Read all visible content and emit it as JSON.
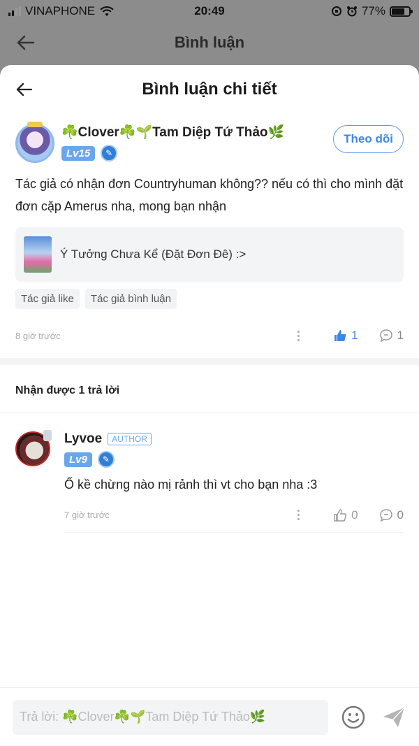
{
  "status": {
    "carrier": "VINAPHONE",
    "time": "20:49",
    "battery_percent": "77%",
    "battery_level": 0.77
  },
  "background_header": {
    "title": "Bình luận"
  },
  "sheet": {
    "title": "Bình luận chi tiết"
  },
  "comment": {
    "username": "☘️Clover☘️🌱Tam Diệp Tứ Thảo🌿",
    "level": "Lv15",
    "follow_label": "Theo dõi",
    "text": "Tác giả có nhận đơn Countryhuman không?? nếu có thì cho mình đặt đơn cặp Amerus nha, mong bạn nhận",
    "story_title": "Ý Tưởng Chưa Kể (Đặt Đơn Đê) :>",
    "tags": [
      "Tác giả like",
      "Tác giả bình luận"
    ],
    "time_ago": "8 giờ trước",
    "likes": "1",
    "replies": "1"
  },
  "replies_section": {
    "title": "Nhận được 1 trả lời"
  },
  "reply": {
    "username": "Lyvoe",
    "author_badge": "AUTHOR",
    "level": "Lv9",
    "text": "Ố kề chừng nào mị rảnh thì vt cho bạn nha :3",
    "time_ago": "7 giờ trước",
    "likes": "0",
    "replies": "0"
  },
  "input": {
    "placeholder": "Trả lời: ☘️Clover☘️🌱Tam Diệp Tứ Thảo🌿"
  },
  "colors": {
    "accent": "#3a88e6",
    "level_badge": "#6aa6ec"
  },
  "icons": [
    "back-arrow-icon",
    "wifi-icon",
    "signal-icon",
    "battery-icon",
    "verified-icon",
    "more-icon",
    "thumbs-up-icon",
    "comment-icon",
    "emoji-icon",
    "send-icon"
  ]
}
